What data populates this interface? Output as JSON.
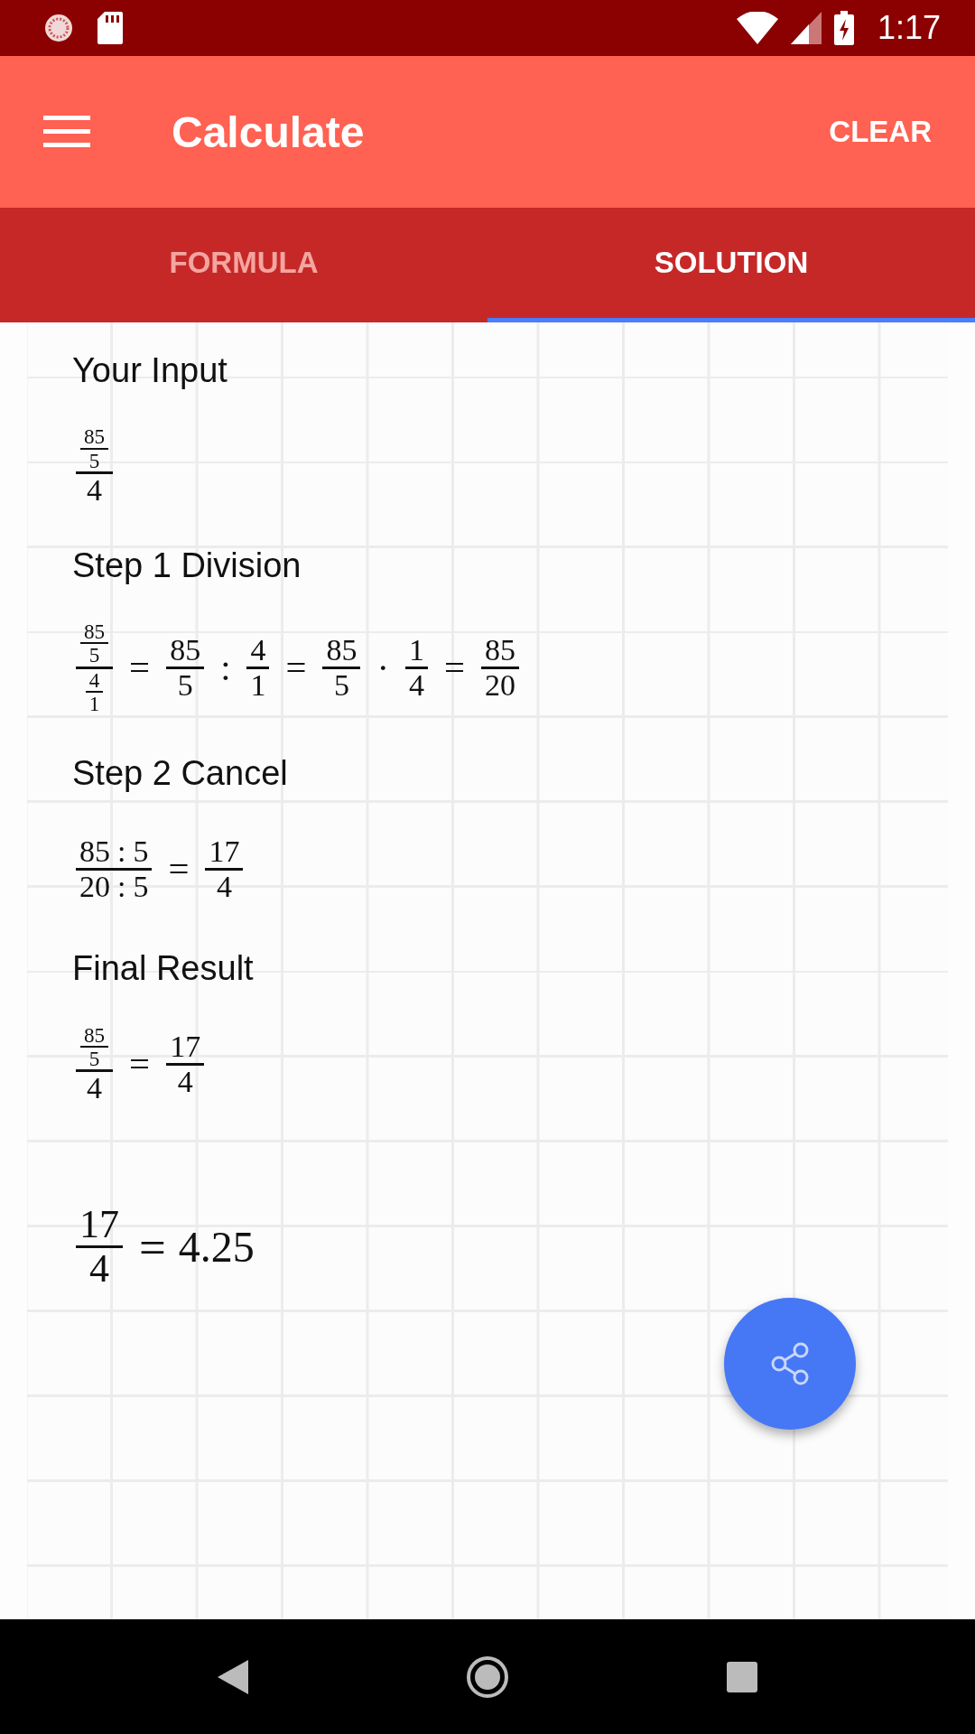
{
  "status_bar": {
    "time": "1:17"
  },
  "app_bar": {
    "title": "Calculate",
    "action": "CLEAR"
  },
  "tabs": [
    {
      "label": "FORMULA",
      "selected": false
    },
    {
      "label": "SOLUTION",
      "selected": true
    }
  ],
  "sections": [
    {
      "kind": "step",
      "heading": "Your Input",
      "expression": [
        {
          "kind": "frac",
          "num": [
            {
              "kind": "frac",
              "num": [
                {
                  "kind": "num",
                  "text": "85"
                }
              ],
              "den": [
                {
                  "kind": "num",
                  "text": "5"
                }
              ]
            }
          ],
          "den": [
            {
              "kind": "num",
              "text": "4"
            }
          ]
        }
      ]
    },
    {
      "kind": "step",
      "heading": "Step 1 Division",
      "expression": [
        {
          "kind": "frac",
          "num": [
            {
              "kind": "frac",
              "num": [
                {
                  "kind": "num",
                  "text": "85"
                }
              ],
              "den": [
                {
                  "kind": "num",
                  "text": "5"
                }
              ]
            }
          ],
          "den": [
            {
              "kind": "frac",
              "num": [
                {
                  "kind": "num",
                  "text": "4"
                }
              ],
              "den": [
                {
                  "kind": "num",
                  "text": "1"
                }
              ]
            }
          ]
        },
        {
          "kind": "op",
          "text": "="
        },
        {
          "kind": "frac",
          "num": [
            {
              "kind": "num",
              "text": "85"
            }
          ],
          "den": [
            {
              "kind": "num",
              "text": "5"
            }
          ]
        },
        {
          "kind": "op",
          "text": ":"
        },
        {
          "kind": "frac",
          "num": [
            {
              "kind": "num",
              "text": "4"
            }
          ],
          "den": [
            {
              "kind": "num",
              "text": "1"
            }
          ]
        },
        {
          "kind": "op",
          "text": "="
        },
        {
          "kind": "frac",
          "num": [
            {
              "kind": "num",
              "text": "85"
            }
          ],
          "den": [
            {
              "kind": "num",
              "text": "5"
            }
          ]
        },
        {
          "kind": "op",
          "text": "·"
        },
        {
          "kind": "frac",
          "num": [
            {
              "kind": "num",
              "text": "1"
            }
          ],
          "den": [
            {
              "kind": "num",
              "text": "4"
            }
          ]
        },
        {
          "kind": "op",
          "text": "="
        },
        {
          "kind": "frac",
          "num": [
            {
              "kind": "num",
              "text": "85"
            }
          ],
          "den": [
            {
              "kind": "num",
              "text": "20"
            }
          ]
        }
      ]
    },
    {
      "kind": "step",
      "heading": "Step 2 Cancel",
      "expression": [
        {
          "kind": "frac",
          "num": [
            {
              "kind": "num",
              "text": "85"
            },
            {
              "kind": "op",
              "text": ":"
            },
            {
              "kind": "num",
              "text": "5"
            }
          ],
          "den": [
            {
              "kind": "num",
              "text": "20"
            },
            {
              "kind": "op",
              "text": ":"
            },
            {
              "kind": "num",
              "text": "5"
            }
          ]
        },
        {
          "kind": "op",
          "text": "="
        },
        {
          "kind": "frac",
          "num": [
            {
              "kind": "num",
              "text": "17"
            }
          ],
          "den": [
            {
              "kind": "num",
              "text": "4"
            }
          ]
        }
      ]
    },
    {
      "kind": "step",
      "heading": "Final Result",
      "expression": [
        {
          "kind": "frac",
          "num": [
            {
              "kind": "frac",
              "num": [
                {
                  "kind": "num",
                  "text": "85"
                }
              ],
              "den": [
                {
                  "kind": "num",
                  "text": "5"
                }
              ]
            }
          ],
          "den": [
            {
              "kind": "num",
              "text": "4"
            }
          ]
        },
        {
          "kind": "op",
          "text": "="
        },
        {
          "kind": "frac",
          "num": [
            {
              "kind": "num",
              "text": "17"
            }
          ],
          "den": [
            {
              "kind": "num",
              "text": "4"
            }
          ]
        }
      ]
    },
    {
      "kind": "decimal",
      "expression": [
        {
          "kind": "frac",
          "num": [
            {
              "kind": "num",
              "text": "17"
            }
          ],
          "den": [
            {
              "kind": "num",
              "text": "4"
            }
          ]
        },
        {
          "kind": "op",
          "text": "="
        },
        {
          "kind": "num",
          "text": "4.25"
        }
      ]
    }
  ]
}
